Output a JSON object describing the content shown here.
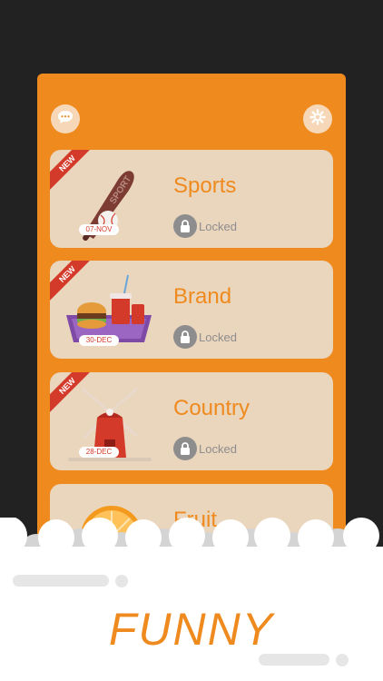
{
  "header": {
    "chat_icon": "chat-bubble-icon",
    "settings_icon": "gear-icon"
  },
  "categories": [
    {
      "name": "Sports",
      "status": "Locked",
      "badge": "NEW",
      "date": "07-NOV",
      "art": "baseball-bat-icon"
    },
    {
      "name": "Brand",
      "status": "Locked",
      "badge": "NEW",
      "date": "30-DEC",
      "art": "fast-food-tray-icon"
    },
    {
      "name": "Country",
      "status": "Locked",
      "badge": "NEW",
      "date": "28-DEC",
      "art": "windmill-icon"
    },
    {
      "name": "Fruit",
      "status": "",
      "badge": "",
      "date": "",
      "art": "orange-slice-icon"
    }
  ],
  "art_labels": {
    "sports_bat_text": "SPORT"
  },
  "footer": {
    "caption": "FUNNY"
  },
  "colors": {
    "accent": "#ef8a1f",
    "background": "#222222",
    "card": "#ead5bd",
    "ribbon": "#d43a2a",
    "lock": "#8d8d8d"
  }
}
